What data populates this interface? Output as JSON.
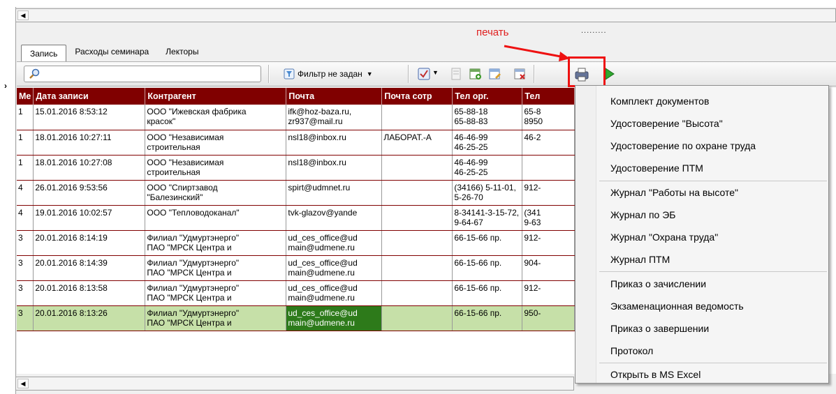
{
  "annotation": {
    "label": "печать",
    "dots": "........."
  },
  "tabs": [
    {
      "label": "Запись"
    },
    {
      "label": "Расходы семинара"
    },
    {
      "label": "Лекторы"
    }
  ],
  "toolbar": {
    "filter_label": "Фильтр не задан"
  },
  "table": {
    "columns": [
      "Ме",
      "Дата записи",
      "Контрагент",
      "Почта",
      "Почта сотр",
      "Тел орг.",
      "Тел"
    ],
    "rows": [
      {
        "c0": "1",
        "c1": "15.01.2016 8:53:12",
        "c2": "ООО \"Ижевская фабрика\nкрасок\"",
        "c3": "ifk@hoz-baza.ru,\nzr937@mail.ru",
        "c4": "",
        "c5": "65-88-18\n65-88-83",
        "c6": "65-8\n8950"
      },
      {
        "c0": "1",
        "c1": "18.01.2016 10:27:11",
        "c2": "ООО \"Независимая\nстроительная",
        "c3": "nsl18@inbox.ru",
        "c4": "ЛАБОРАТ.-А",
        "c5": "46-46-99\n46-25-25",
        "c6": "46-2"
      },
      {
        "c0": "1",
        "c1": "18.01.2016 10:27:08",
        "c2": "ООО \"Независимая\nстроительная",
        "c3": "nsl18@inbox.ru",
        "c4": "",
        "c5": "46-46-99\n46-25-25",
        "c6": ""
      },
      {
        "c0": "4",
        "c1": "26.01.2016 9:53:56",
        "c2": "ООО \"Спиртзавод\n\"Балезинский\"",
        "c3": "spirt@udmnet.ru",
        "c4": "",
        "c5": "(34166) 5-11-01,\n5-26-70",
        "c6": "912-"
      },
      {
        "c0": "4",
        "c1": "19.01.2016 10:02:57",
        "c2": "ООО \"Тепловодоканал\"",
        "c3": "tvk-glazov@yande",
        "c4": "",
        "c5": "8-34141-3-15-72,\n9-64-67",
        "c6": "(341\n9-63"
      },
      {
        "c0": "3",
        "c1": "20.01.2016 8:14:19",
        "c2": "Филиал \"Удмуртэнерго\"\nПАО \"МРСК Центра и",
        "c3": "ud_ces_office@ud\nmain@udmene.ru",
        "c4": "",
        "c5": "66-15-66 пр.",
        "c6": "912-"
      },
      {
        "c0": "3",
        "c1": "20.01.2016 8:14:39",
        "c2": "Филиал \"Удмуртэнерго\"\nПАО \"МРСК Центра и",
        "c3": "ud_ces_office@ud\nmain@udmene.ru",
        "c4": "",
        "c5": "66-15-66 пр.",
        "c6": "904-"
      },
      {
        "c0": "3",
        "c1": "20.01.2016 8:13:58",
        "c2": "Филиал \"Удмуртэнерго\"\nПАО \"МРСК Центра и",
        "c3": "ud_ces_office@ud\nmain@udmene.ru",
        "c4": "",
        "c5": "66-15-66 пр.",
        "c6": "912-"
      },
      {
        "c0": "3",
        "c1": "20.01.2016 8:13:26",
        "c2": "Филиал \"Удмуртэнерго\"\nПАО \"МРСК Центра и",
        "c3": "ud_ces_office@ud\nmain@udmene.ru",
        "c4": "",
        "c5": "66-15-66 пр.",
        "c6": "950-"
      }
    ]
  },
  "menu": {
    "groups": [
      [
        "Комплект документов",
        "Удостоверение \"Высота\"",
        "Удостоверение по охране труда",
        "Удостоверение ПТМ"
      ],
      [
        "Журнал \"Работы на высоте\"",
        "Журнал по ЭБ",
        "Журнал \"Охрана труда\"",
        "Журнал ПТМ"
      ],
      [
        "Приказ о зачислении",
        "Экзаменационная ведомость",
        "Приказ о завершении",
        "Протокол"
      ],
      [
        "Открыть в MS Excel"
      ]
    ]
  },
  "colors": {
    "header_bg": "#800000",
    "highlight_row": "#c6e0a8",
    "annotation": "#e02020"
  }
}
